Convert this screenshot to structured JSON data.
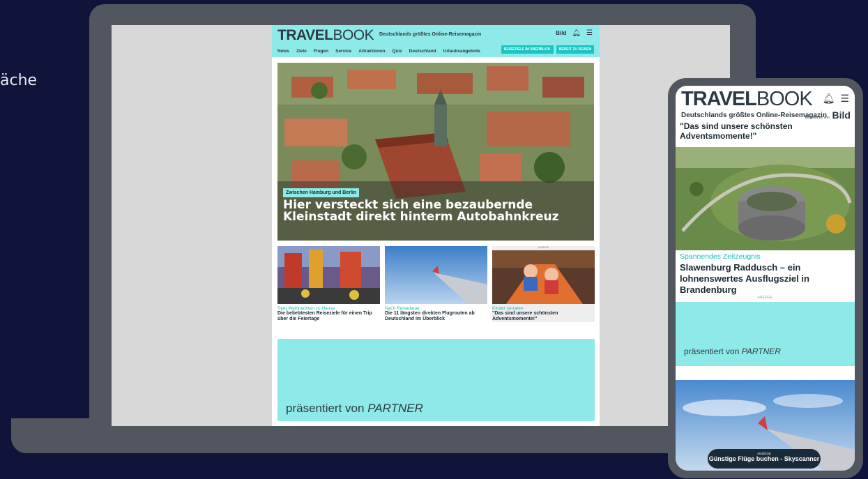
{
  "side_text": "äche",
  "site": {
    "logo_bold": "TRAVEL",
    "logo_light": "BOOK",
    "tagline": "Deutschlands größtes Online-Reisemagazin",
    "bild_mini": "Bild",
    "nav": [
      "News",
      "Ziele",
      "Flugen",
      "Service",
      "Attraktionen",
      "Quiz",
      "Deutschland",
      "Urlaubsangebote"
    ],
    "btn_reiseziele": "REISEZIELE IM ÜBERBLICK",
    "btn_bereit": "BEREIT ZU REISEN",
    "hero_kicker": "Zwischen Hamburg und Berlin",
    "hero_title": "Hier versteckt sich eine bezaubernde Kleinstadt direkt hinterm Autobahnkreuz",
    "teasers": [
      {
        "kicker": "Statt Weihnachten zu Hause",
        "title": "Die beliebtesten Reiseziele für einen Trip über die Feiertage"
      },
      {
        "kicker": "Nach Reisedauer",
        "title": "Die 11 längsten direkten Flugrouten ab Deutschland im Überblick"
      },
      {
        "kicker": "Kinder verraten",
        "title": "\"Das sind unsere schönsten Adventsmomente!\"",
        "ad_label": "ANZEIGE"
      }
    ],
    "partner_prefix": "präsentiert von ",
    "partner_name": "PARTNER"
  },
  "phone": {
    "logo_bold": "TRAVEL",
    "logo_light": "BOOK",
    "tagline": "Deutschlands größtes Online-Reisemagazin",
    "bild": "Bild",
    "bild_small": "Eine Marke von",
    "headline": "\"Das sind unsere schönsten Adventsmomente!\"",
    "kicker": "Spannendes Zeitzeugnis",
    "title": "Slawenburg Raddusch – ein lohnenswertes Ausflugsziel in Brandenburg",
    "ad_label": "ANZEIGE",
    "partner_prefix": "präsentiert von ",
    "partner_name": "PARTNER",
    "pill_label": "ANZEIGE",
    "pill_text": "Günstige Flüge buchen - Skyscanner"
  },
  "colors": {
    "accent": "#8eeae8",
    "accent_text": "#19bdb9",
    "dark": "#2d3a44",
    "background": "#10143a",
    "device": "#52575f"
  }
}
